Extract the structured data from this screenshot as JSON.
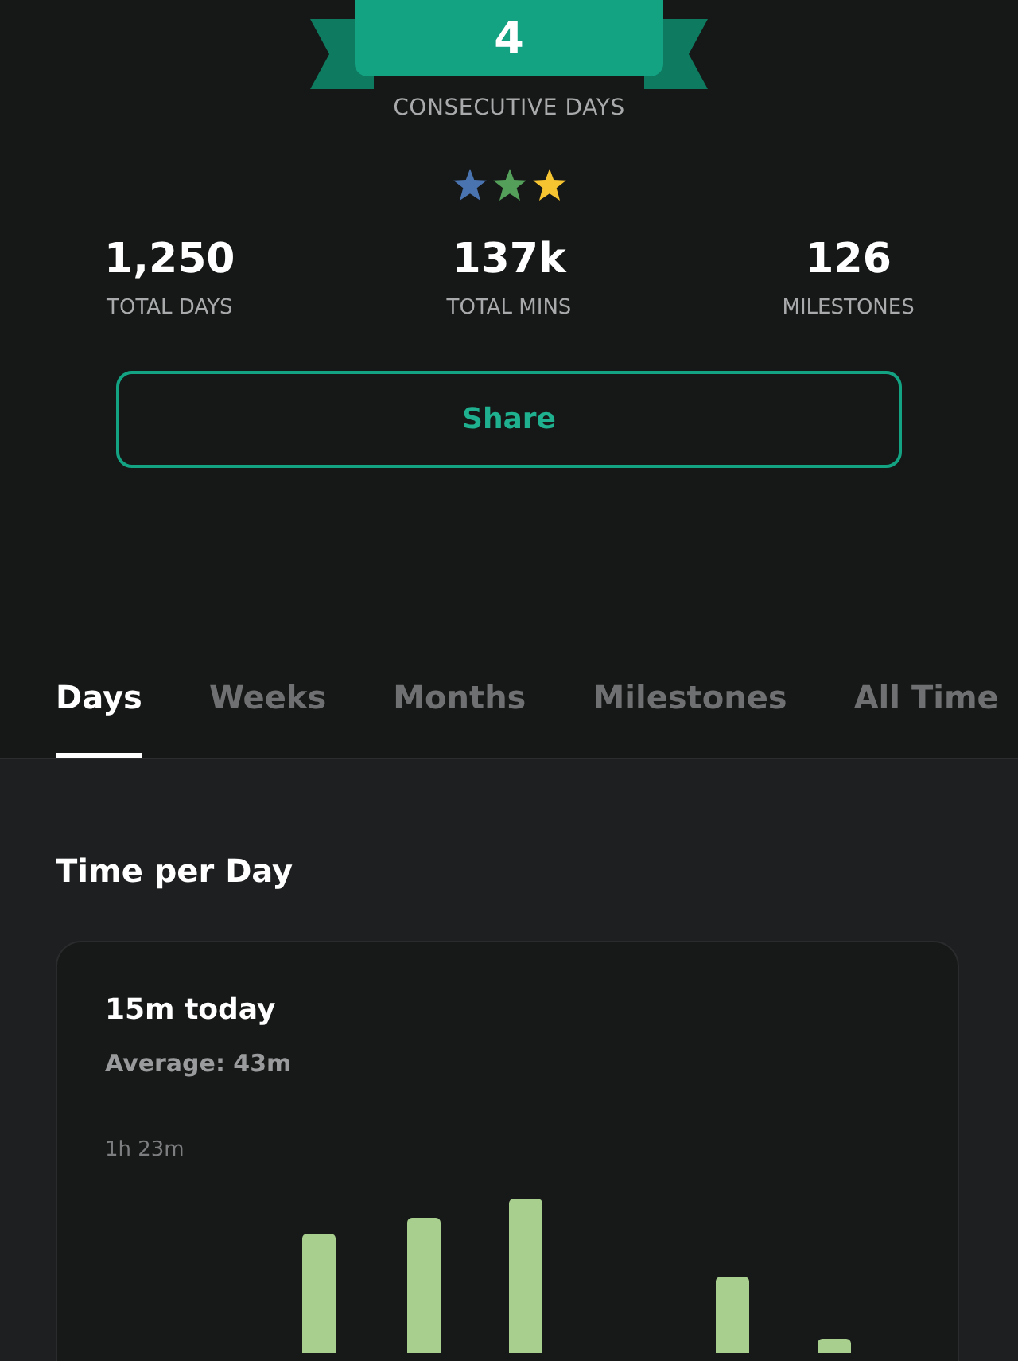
{
  "streak": {
    "count": "4",
    "label": "CONSECUTIVE DAYS"
  },
  "streak_stars": [
    {
      "color": "#4a74b0"
    },
    {
      "color": "#54a05a"
    },
    {
      "color": "#f6c431"
    }
  ],
  "stats": [
    {
      "value": "1,250",
      "label": "TOTAL DAYS"
    },
    {
      "value": "137k",
      "label": "TOTAL MINS"
    },
    {
      "value": "126",
      "label": "MILESTONES"
    }
  ],
  "share_button": "Share",
  "tabs": [
    {
      "label": "Days",
      "selected": true
    },
    {
      "label": "Weeks",
      "selected": false
    },
    {
      "label": "Months",
      "selected": false
    },
    {
      "label": "Milestones",
      "selected": false
    },
    {
      "label": "All Time",
      "selected": false
    }
  ],
  "section_title": "Time per Day",
  "card": {
    "headline": "15m today",
    "average": "Average: 43m",
    "axis_label": "1h 23m"
  }
}
